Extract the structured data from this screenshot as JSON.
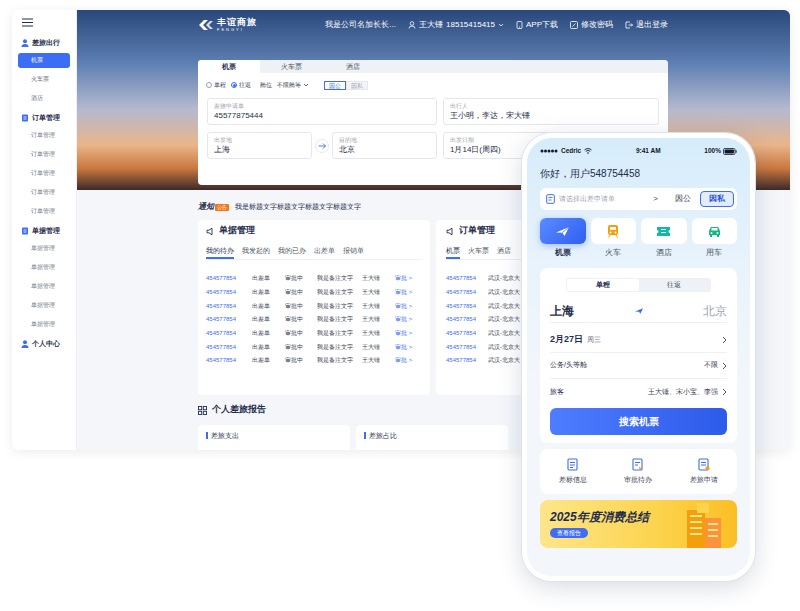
{
  "sidebar": {
    "sections": [
      {
        "title": "差旅出行",
        "items": [
          {
            "label": "机票",
            "selected": true
          },
          {
            "label": "火车票",
            "selected": false
          },
          {
            "label": "酒店",
            "selected": false
          }
        ]
      },
      {
        "title": "订单管理",
        "items": [
          {
            "label": "订单管理",
            "selected": false
          },
          {
            "label": "订单管理",
            "selected": false
          },
          {
            "label": "订单管理",
            "selected": false
          },
          {
            "label": "订单管理",
            "selected": false
          },
          {
            "label": "订单管理",
            "selected": false
          }
        ]
      },
      {
        "title": "单据管理",
        "items": [
          {
            "label": "单据管理",
            "selected": false
          },
          {
            "label": "单据管理",
            "selected": false
          },
          {
            "label": "单据管理",
            "selected": false
          },
          {
            "label": "单据管理",
            "selected": false
          },
          {
            "label": "单据管理",
            "selected": false
          }
        ]
      },
      {
        "title": "个人中心",
        "items": []
      }
    ]
  },
  "header": {
    "logo": "丰谊商旅",
    "logo_sub": "FENGYI",
    "company": "我是公司名加长长...",
    "user": "王大锤",
    "phone": "18515415415",
    "links": [
      "APP下载",
      "修改密码",
      "退出登录"
    ]
  },
  "search_card": {
    "tabs": [
      {
        "label": "机票",
        "selected": true
      },
      {
        "label": "火车票",
        "selected": false
      },
      {
        "label": "酒店",
        "selected": false
      }
    ],
    "trip_types": [
      {
        "label": "单程",
        "selected": false
      },
      {
        "label": "往返",
        "selected": true
      }
    ],
    "cabin_label": "舱位",
    "cabin_value": "不限舱等",
    "purposes": [
      {
        "label": "因公",
        "selected": true
      },
      {
        "label": "因私",
        "selected": false
      }
    ],
    "fields": [
      {
        "label": "差旅申请单",
        "value": "45577875444"
      },
      {
        "label": "出行人",
        "value": "王小明，李达，宋大锤"
      },
      {
        "label": "出发地",
        "value": "上海"
      },
      {
        "label": "目的地",
        "value": "北京"
      },
      {
        "label": "出发日期",
        "value": "1月14日(周四)"
      }
    ]
  },
  "notice": {
    "badge": "通知",
    "tag": "公告",
    "text": "我是标题文字标题文字标题文字标题文字"
  },
  "documents": {
    "title": "单据管理",
    "tabs": [
      {
        "label": "我的待办",
        "selected": true
      },
      {
        "label": "我发起的",
        "selected": false
      },
      {
        "label": "我的已办",
        "selected": false
      },
      {
        "label": "出差单",
        "selected": false
      },
      {
        "label": "报销单",
        "selected": false
      }
    ],
    "rows": [
      [
        "454577854",
        "出差单",
        "审批中",
        "我是备注文字",
        "王大锤",
        "审批 >"
      ],
      [
        "454577854",
        "出差单",
        "审批中",
        "我是备注文字",
        "王大锤",
        "审批 >"
      ],
      [
        "454577854",
        "出差单",
        "审批中",
        "我是备注文字",
        "王大锤",
        "审批 >"
      ],
      [
        "454577854",
        "出差单",
        "审批中",
        "我是备注文字",
        "王大锤",
        "审批 >"
      ],
      [
        "454577854",
        "出差单",
        "审批中",
        "我是备注文字",
        "王大锤",
        "审批 >"
      ],
      [
        "454577854",
        "出差单",
        "审批中",
        "我是备注文字",
        "王大锤",
        "审批 >"
      ],
      [
        "454577854",
        "出差单",
        "审批中",
        "我是备注文字",
        "王大锤",
        "审批 >"
      ]
    ]
  },
  "orders": {
    "title": "订单管理",
    "tabs": [
      {
        "label": "机票",
        "selected": true
      },
      {
        "label": "火车票",
        "selected": false
      },
      {
        "label": "酒店",
        "selected": false
      }
    ],
    "rows": [
      [
        "454577854",
        "武汉-北京大"
      ],
      [
        "454577854",
        "武汉-北京大"
      ],
      [
        "454577854",
        "武汉-北京大"
      ],
      [
        "454577854",
        "武汉-北京大"
      ],
      [
        "454577854",
        "武汉-北京大"
      ],
      [
        "454577854",
        "武汉-北京大"
      ],
      [
        "454577854",
        "武汉-北京大"
      ]
    ]
  },
  "report": {
    "title": "个人差旅报告",
    "cards": [
      "差旅支出",
      "差旅占比"
    ]
  },
  "phone": {
    "status": {
      "carrier": "Cedric",
      "time": "9:41 AM",
      "battery": "100%"
    },
    "greeting": "你好，用户548754458",
    "apply": {
      "placeholder": "请选择出差申请单",
      "arrow": ">",
      "purposes": [
        {
          "label": "因公",
          "selected": false
        },
        {
          "label": "因私",
          "selected": true
        }
      ]
    },
    "services": [
      {
        "label": "机票",
        "selected": true
      },
      {
        "label": "火车",
        "selected": false
      },
      {
        "label": "酒店",
        "selected": false
      },
      {
        "label": "用车",
        "selected": false
      }
    ],
    "trip_types": [
      {
        "label": "单程",
        "selected": true
      },
      {
        "label": "往返",
        "selected": false
      }
    ],
    "from": "上海",
    "to": "北京",
    "date": "2月27日",
    "weekday": "周三",
    "options": [
      {
        "label": "公务/头等舱",
        "value": "不限"
      },
      {
        "label": "旅客",
        "value": "王大锤、宋小宝、李强"
      }
    ],
    "search_button": "搜索机票",
    "shortcuts": [
      "差标信息",
      "审批待办",
      "差旅申请"
    ],
    "banner": {
      "title": "2025年度消费总结",
      "button": "查看报告"
    }
  }
}
